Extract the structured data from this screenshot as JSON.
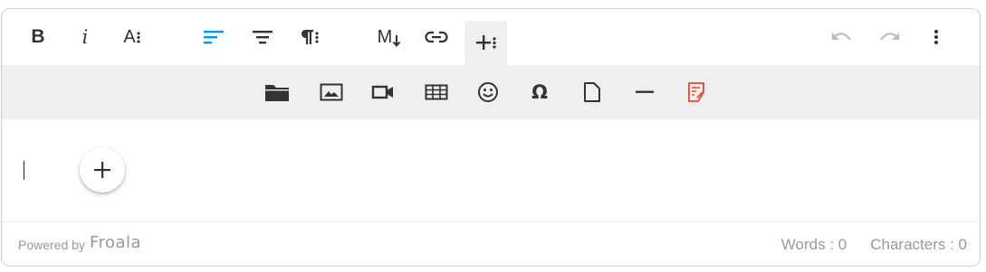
{
  "toolbar": {
    "bold_label": "B",
    "italic_label": "i",
    "text_more_label": "A",
    "markdown_label": "M",
    "more_rich_symbol": "+",
    "icons": {
      "bold": "bold-icon",
      "italic": "italic-icon",
      "text_more": "font-size-more-icon",
      "align": "align-left-icon",
      "align_center": "align-center-icon",
      "paragraph_more": "paragraph-more-icon",
      "markdown": "markdown-icon",
      "link": "link-icon",
      "more_rich": "plus-more-icon",
      "undo": "undo-icon",
      "redo": "redo-icon",
      "more_misc": "vertical-dots-icon"
    }
  },
  "more_toolbar": {
    "items": [
      {
        "name": "insert-files-button",
        "icon": "folder-icon"
      },
      {
        "name": "insert-image-button",
        "icon": "image-icon"
      },
      {
        "name": "insert-video-button",
        "icon": "video-icon"
      },
      {
        "name": "insert-table-button",
        "icon": "table-icon"
      },
      {
        "name": "emoticons-button",
        "icon": "smiley-icon"
      },
      {
        "name": "special-characters-button",
        "icon": "omega-icon"
      },
      {
        "name": "insert-file-button",
        "icon": "file-icon"
      },
      {
        "name": "insert-hr-button",
        "icon": "horizontal-line-icon"
      },
      {
        "name": "embedly-button",
        "icon": "document-edit-icon"
      }
    ],
    "special_char_label": "Ω"
  },
  "editor": {
    "quick_insert_icon": "plus-icon"
  },
  "footer": {
    "powered_by": "Powered by",
    "brand": "Froala",
    "words": "Words : 0",
    "characters": "Characters : 0"
  },
  "colors": {
    "active_blue": "#0098f7",
    "embed_red": "#e8452c",
    "disabled_gray": "#bdbdbd",
    "toolbar_bg": "#efefef",
    "footer_text": "#999999"
  }
}
